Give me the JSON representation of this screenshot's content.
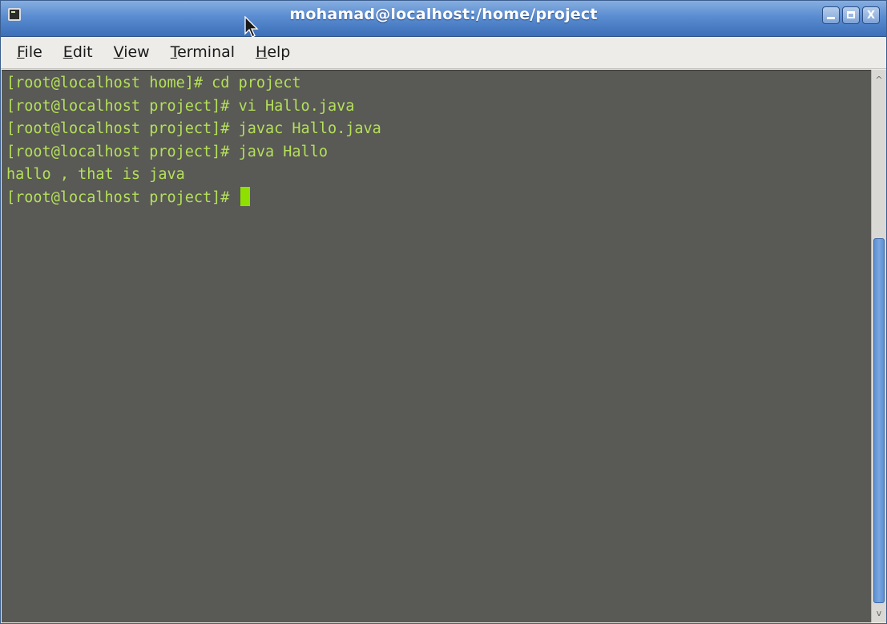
{
  "window": {
    "title": "mohamad@localhost:/home/project",
    "app_icon": "terminal-icon",
    "controls": {
      "minimize_icon": "minimize-icon",
      "maximize_icon": "maximize-icon",
      "close_icon": "close-icon",
      "close_glyph": "X"
    }
  },
  "menubar": {
    "items": [
      {
        "mnemonic": "F",
        "rest": "ile"
      },
      {
        "mnemonic": "E",
        "rest": "dit"
      },
      {
        "mnemonic": "V",
        "rest": "iew"
      },
      {
        "mnemonic": "T",
        "rest": "erminal"
      },
      {
        "mnemonic": "H",
        "rest": "elp"
      }
    ]
  },
  "terminal": {
    "lines": [
      "[root@localhost home]# cd project",
      "[root@localhost project]# vi Hallo.java",
      "[root@localhost project]# javac Hallo.java",
      "[root@localhost project]# java Hallo",
      "hallo , that is java"
    ],
    "current_prompt": "[root@localhost project]# ",
    "text_color": "#b4e05a",
    "background_color": "#595955",
    "cursor_color": "#8ee000"
  },
  "scrollbar": {
    "up_glyph": "^",
    "down_glyph": "v"
  }
}
